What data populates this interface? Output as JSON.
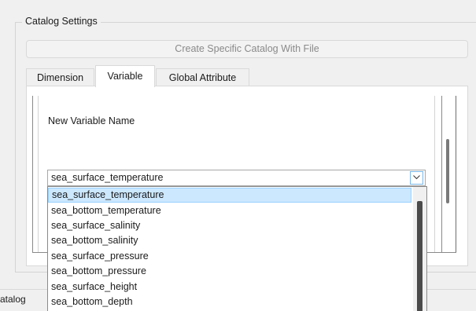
{
  "group": {
    "title": "Catalog Settings"
  },
  "create_button": {
    "label": "Create Specific Catalog With File"
  },
  "tabs": [
    {
      "label": "Dimension",
      "active": false
    },
    {
      "label": "Variable",
      "active": true
    },
    {
      "label": "Global Attribute",
      "active": false
    }
  ],
  "variable_panel": {
    "field_label": "New Variable Name",
    "combo_value": "sea_surface_temperature",
    "options": [
      "sea_surface_temperature",
      "sea_bottom_temperature",
      "sea_surface_salinity",
      "sea_bottom_salinity",
      "sea_surface_pressure",
      "sea_bottom_pressure",
      "sea_surface_height",
      "sea_bottom_depth"
    ],
    "selected_index": 0
  },
  "status": {
    "catalog_label": "atalog"
  },
  "colors": {
    "selection_bg": "#cce8ff",
    "selection_border": "#99d1ff",
    "combo_button_border": "#7ab7e8"
  }
}
